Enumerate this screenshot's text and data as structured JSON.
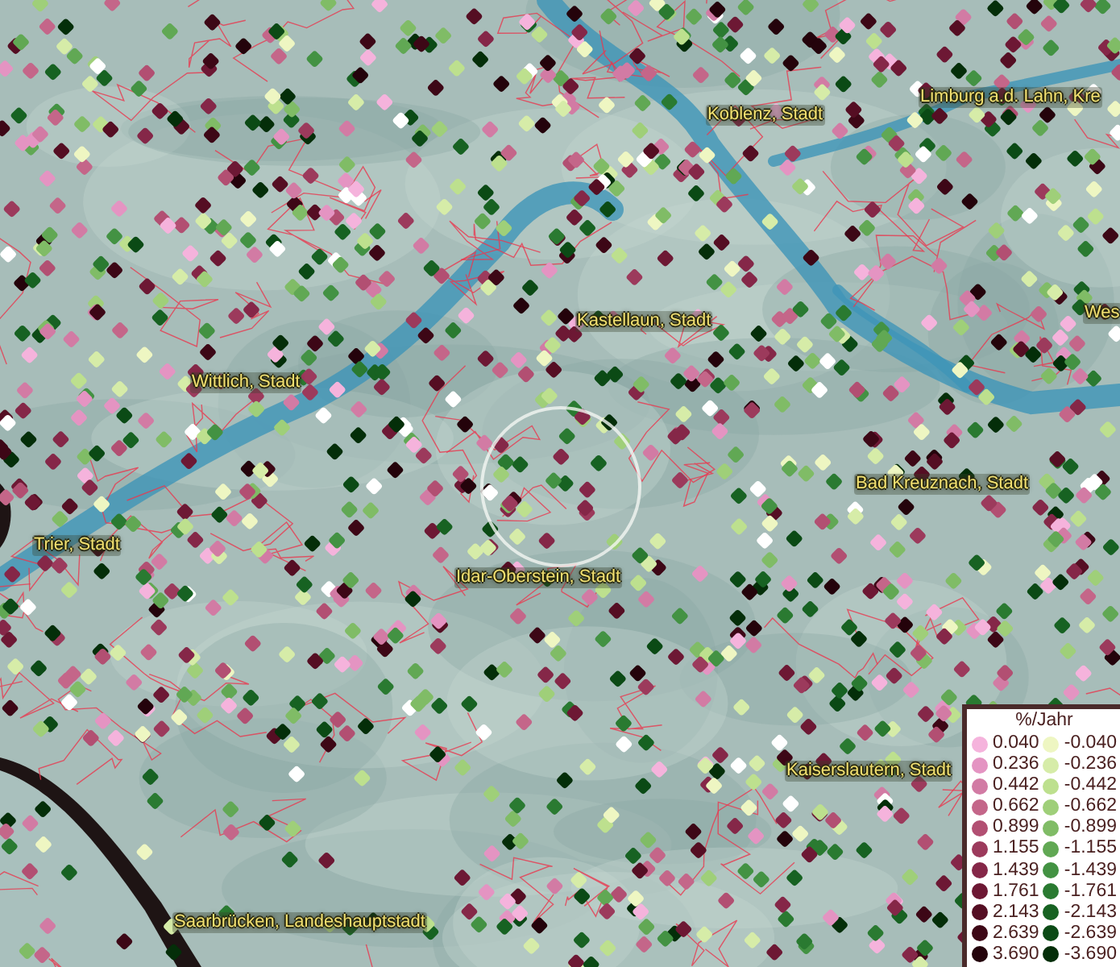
{
  "map": {
    "places": [
      {
        "label": "Koblenz, Stadt"
      },
      {
        "label": "Limburg a.d. Lahn, Kre"
      },
      {
        "label": "Wes"
      },
      {
        "label": "Kastellaun, Stadt"
      },
      {
        "label": "Wittlich, Stadt"
      },
      {
        "label": "Bad Kreuznach, Stadt"
      },
      {
        "label": "Trier, Stadt"
      },
      {
        "label": "Idar-Oberstein, Stadt"
      },
      {
        "label": "Kaiserslautern, Stadt"
      },
      {
        "label": "Saarbrücken, Landeshauptstadt"
      }
    ]
  },
  "legend": {
    "title": "%/Jahr",
    "positive": [
      {
        "value": "0.040",
        "color": "#f5b3dc"
      },
      {
        "value": "0.236",
        "color": "#e494c2"
      },
      {
        "value": "0.442",
        "color": "#d27ba4"
      },
      {
        "value": "0.662",
        "color": "#c46689"
      },
      {
        "value": "0.899",
        "color": "#b24f72"
      },
      {
        "value": "1.155",
        "color": "#9c3a5c"
      },
      {
        "value": "1.439",
        "color": "#852748"
      },
      {
        "value": "1.761",
        "color": "#6d1834"
      },
      {
        "value": "2.143",
        "color": "#550e23"
      },
      {
        "value": "2.639",
        "color": "#3d0716"
      },
      {
        "value": "3.690",
        "color": "#24030b"
      }
    ],
    "negative": [
      {
        "value": "-0.040",
        "color": "#eef6c2"
      },
      {
        "value": "-0.236",
        "color": "#d6eca8"
      },
      {
        "value": "-0.442",
        "color": "#bde08e"
      },
      {
        "value": "-0.662",
        "color": "#9fcf79"
      },
      {
        "value": "-0.899",
        "color": "#80bc66"
      },
      {
        "value": "-1.155",
        "color": "#61a854"
      },
      {
        "value": "-1.439",
        "color": "#439243"
      },
      {
        "value": "-1.761",
        "color": "#2a7a31"
      },
      {
        "value": "-2.143",
        "color": "#176222"
      },
      {
        "value": "-2.639",
        "color": "#0b4a15"
      },
      {
        "value": "-3.690",
        "color": "#042e09"
      }
    ]
  }
}
